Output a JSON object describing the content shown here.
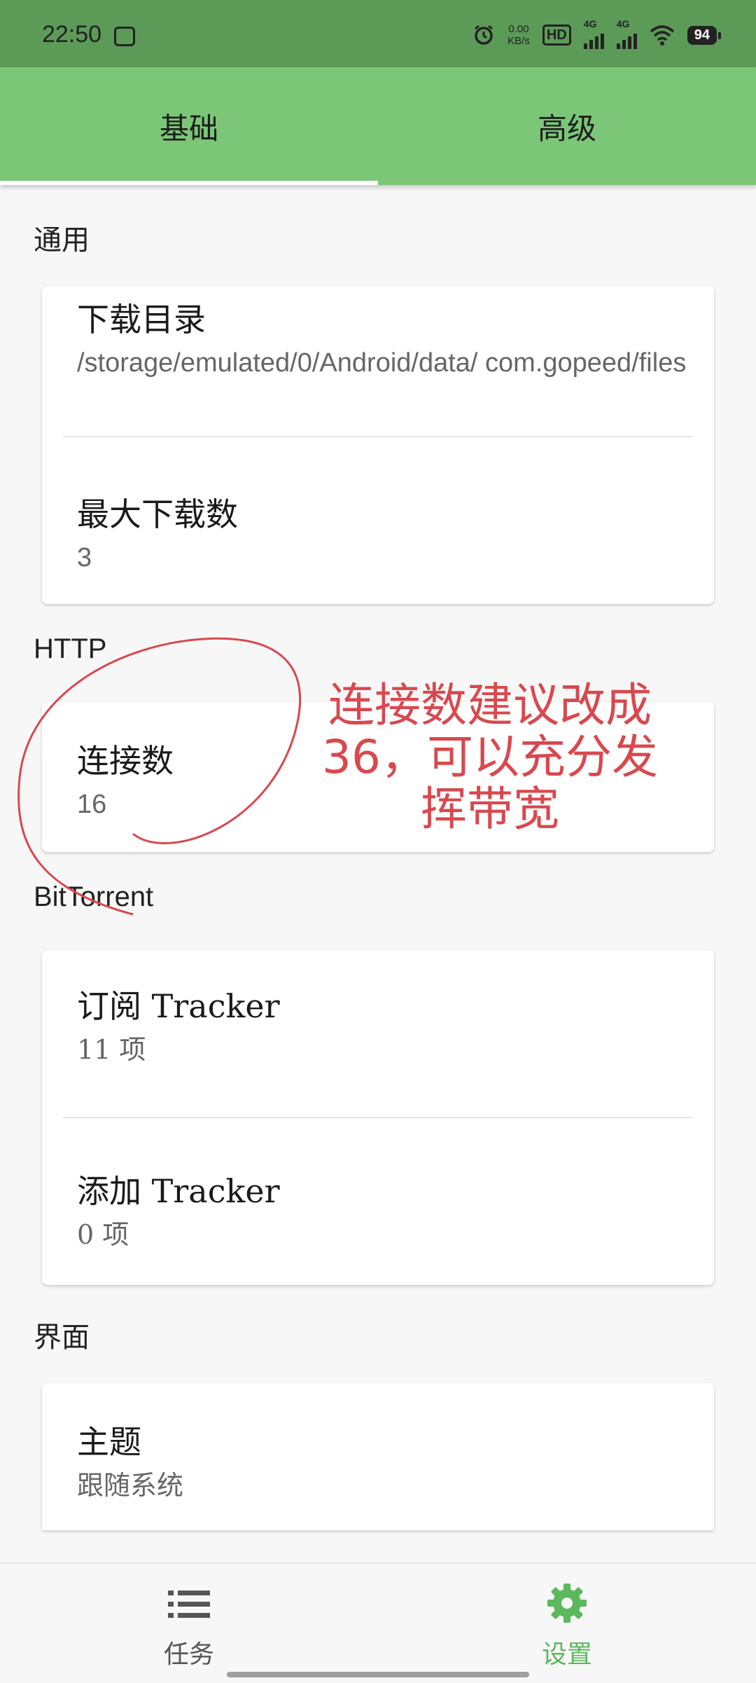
{
  "status_bar": {
    "time": "22:50",
    "net_speed_value": "0.00",
    "net_speed_unit": "KB/s",
    "hd_label": "HD",
    "sim1_label": "4G",
    "sim2_label": "4G",
    "battery": "94"
  },
  "tabs": [
    {
      "label": "基础",
      "selected": true
    },
    {
      "label": "高级",
      "selected": false
    }
  ],
  "sections": {
    "general": {
      "title": "通用",
      "items": [
        {
          "title": "下载目录",
          "value": "/storage/emulated/0/Android/data/ com.gopeed/files"
        },
        {
          "title": "最大下载数",
          "value": "3"
        }
      ]
    },
    "http": {
      "title": "HTTP",
      "items": [
        {
          "title": "连接数",
          "value": "16"
        }
      ]
    },
    "bittorrent": {
      "title": "BitTorrent",
      "items": [
        {
          "title": "订阅 Tracker",
          "value": "11 项"
        },
        {
          "title": "添加 Tracker",
          "value": "0 项"
        }
      ]
    },
    "ui": {
      "title": "界面",
      "items": [
        {
          "title": "主题",
          "value": "跟随系统"
        }
      ]
    }
  },
  "annotation": {
    "line1": "连接数建议改成",
    "line2": "36，可以充分发",
    "line3": "挥带宽",
    "color": "#d9484e"
  },
  "bottom_nav": {
    "items": [
      {
        "label": "任务",
        "icon": "list-icon",
        "selected": false
      },
      {
        "label": "设置",
        "icon": "gear-icon",
        "selected": true
      }
    ],
    "accent": "#5cb85c"
  },
  "colors": {
    "primary": "#7bc677",
    "status_bar": "#5c9a58"
  }
}
